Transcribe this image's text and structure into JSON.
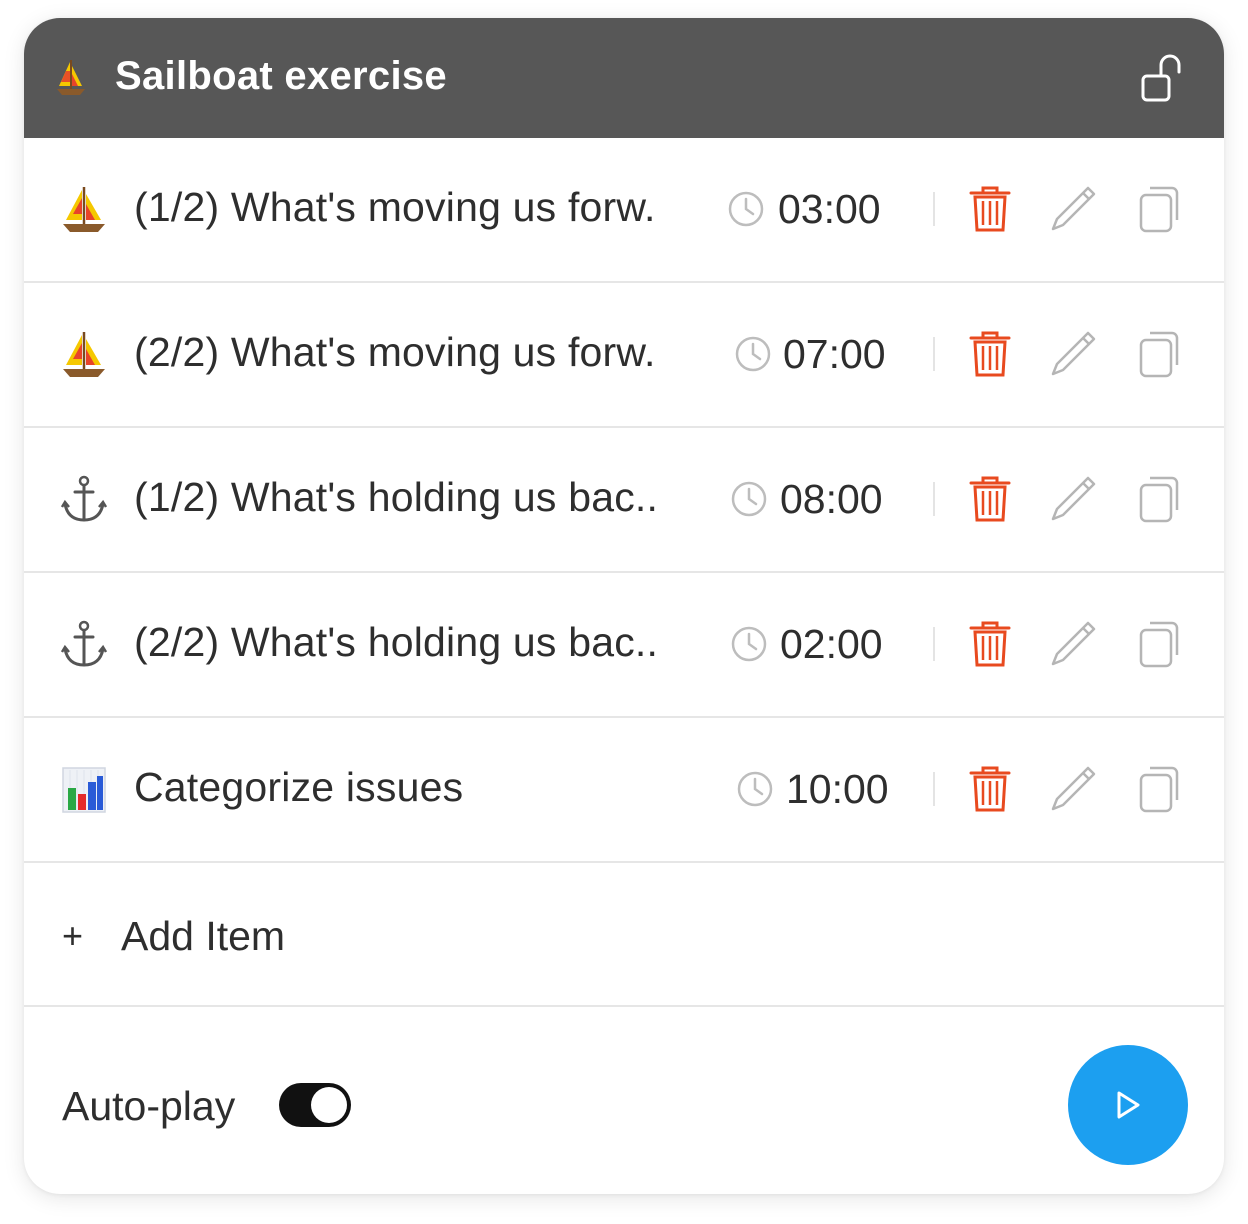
{
  "header": {
    "emoji": "sailboat-emoji",
    "title": "Sailboat exercise",
    "lock_icon": "unlock-icon"
  },
  "items": [
    {
      "emoji": "sailboat",
      "title": "(1/2) What's moving us forw.",
      "duration": "03:00"
    },
    {
      "emoji": "sailboat",
      "title": "(2/2) What's moving us forw.",
      "duration": "07:00"
    },
    {
      "emoji": "anchor",
      "title": "(1/2) What's holding us bac..",
      "duration": "08:00"
    },
    {
      "emoji": "anchor",
      "title": "(2/2) What's holding us bac..",
      "duration": "02:00"
    },
    {
      "emoji": "bar-chart",
      "title": "Categorize issues",
      "duration": "10:00"
    }
  ],
  "add_item": {
    "plus": "+",
    "label": "Add Item"
  },
  "footer": {
    "autoplay_label": "Auto-play",
    "autoplay_on": true,
    "play_icon": "play-icon"
  },
  "colors": {
    "header_bg": "#575757",
    "trash": "#e84a1f",
    "play_button": "#1c9ff0",
    "icon_gray": "#b5b5b5"
  }
}
